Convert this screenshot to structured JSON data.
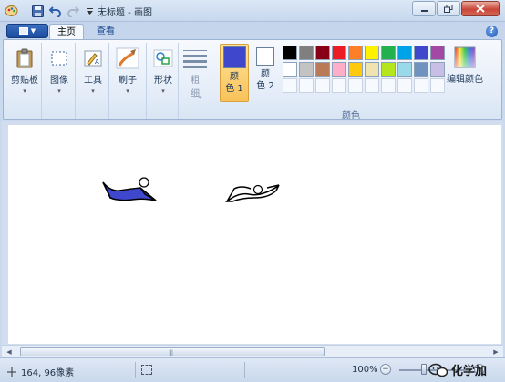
{
  "window": {
    "title": "无标题 - 画图"
  },
  "tabs": {
    "menu_button": "app-menu",
    "home": "主页",
    "view": "查看"
  },
  "ribbon": {
    "clipboard": "剪贴板",
    "image": "图像",
    "tools": "工具",
    "brushes": "刷子",
    "shapes": "形状",
    "size_top": "粗",
    "size_bottom": "细",
    "color1_top": "颜",
    "color1_bottom": "色 1",
    "color2_top": "颜",
    "color2_bottom": "色 2",
    "edit_colors": "编辑颜色",
    "colors_group": "颜色"
  },
  "colors": {
    "color1": "#3f48cc",
    "color2": "#ffffff",
    "palette_row1": [
      "#000000",
      "#7f7f7f",
      "#880015",
      "#ed1c24",
      "#ff7f27",
      "#fff200",
      "#22b14c",
      "#00a2e8",
      "#3f48cc",
      "#a349a4"
    ],
    "palette_row2": [
      "#ffffff",
      "#c3c3c3",
      "#b97a57",
      "#ffaec9",
      "#ffc90e",
      "#efe4b0",
      "#b5e61d",
      "#99d9ea",
      "#7092be",
      "#c8bfe7"
    ]
  },
  "status": {
    "position": "164, 96像素",
    "zoom": "100%",
    "zoom_minus": "−",
    "zoom_plus": "+"
  },
  "watermark": {
    "text": "化学加"
  }
}
